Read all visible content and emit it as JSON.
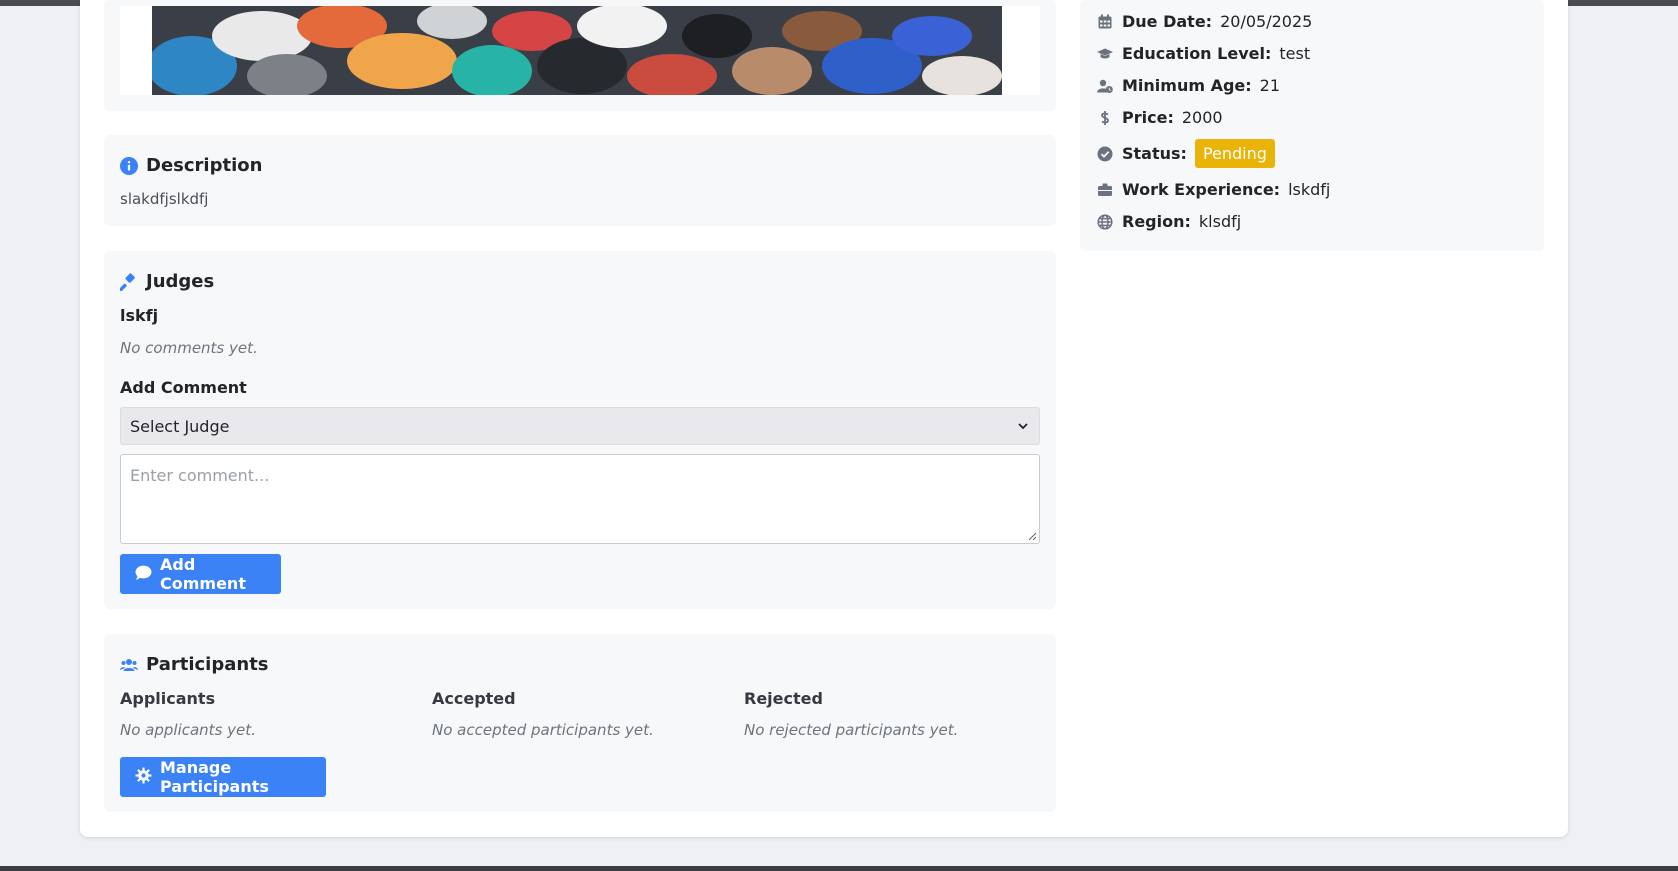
{
  "details": {
    "due_date": {
      "label": "Due Date:",
      "value": "20/05/2025",
      "icon": "calendar-icon"
    },
    "education_level": {
      "label": "Education Level:",
      "value": "test",
      "icon": "graduation-cap-icon"
    },
    "minimum_age": {
      "label": "Minimum Age:",
      "value": "21",
      "icon": "user-clock-icon"
    },
    "price": {
      "label": "Price:",
      "value": "2000",
      "icon": "dollar-icon"
    },
    "status": {
      "label": "Status:",
      "value": "Pending",
      "icon": "check-circle-icon",
      "badge_color": "#eab308"
    },
    "work_experience": {
      "label": "Work Experience:",
      "value": "lskdfj",
      "icon": "briefcase-icon"
    },
    "region": {
      "label": "Region:",
      "value": "klsdfj",
      "icon": "globe-icon"
    }
  },
  "description": {
    "title": "Description",
    "text": "slakdfjslkdfj",
    "icon": "info-circle-icon"
  },
  "judges": {
    "title": "Judges",
    "icon": "gavel-icon",
    "judge_name": "lskfj",
    "no_comments": "No comments yet.",
    "add_comment_label": "Add Comment",
    "select_value": "Select Judge",
    "comment_placeholder": "Enter comment...",
    "add_comment_button": "Add Comment"
  },
  "participants": {
    "title": "Participants",
    "icon": "users-icon",
    "columns": [
      {
        "heading": "Applicants",
        "empty": "No applicants yet."
      },
      {
        "heading": "Accepted",
        "empty": "No accepted participants yet."
      },
      {
        "heading": "Rejected",
        "empty": "No rejected participants yet."
      }
    ],
    "manage_button": "Manage Participants"
  },
  "colors": {
    "accent": "#3b82f6",
    "pending": "#eab308",
    "panel": "#f7f8fa"
  }
}
